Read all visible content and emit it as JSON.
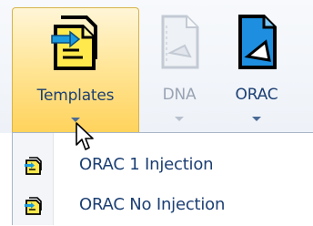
{
  "ribbon": {
    "buttons": [
      {
        "label": "Templates",
        "icon": "template-document-icon",
        "state": "pressed"
      },
      {
        "label": "DNA",
        "icon": "dna-document-icon",
        "state": "disabled"
      },
      {
        "label": "ORAC",
        "icon": "orac-document-icon",
        "state": "normal"
      }
    ]
  },
  "menu": {
    "items": [
      {
        "label": "ORAC 1 Injection",
        "icon": "template-small-icon"
      },
      {
        "label": "ORAC No Injection",
        "icon": "template-small-icon"
      }
    ]
  },
  "colors": {
    "pressed_fill": "#ffd35c",
    "label_text": "#1c3f73",
    "disabled_text": "#9aa4b3"
  }
}
